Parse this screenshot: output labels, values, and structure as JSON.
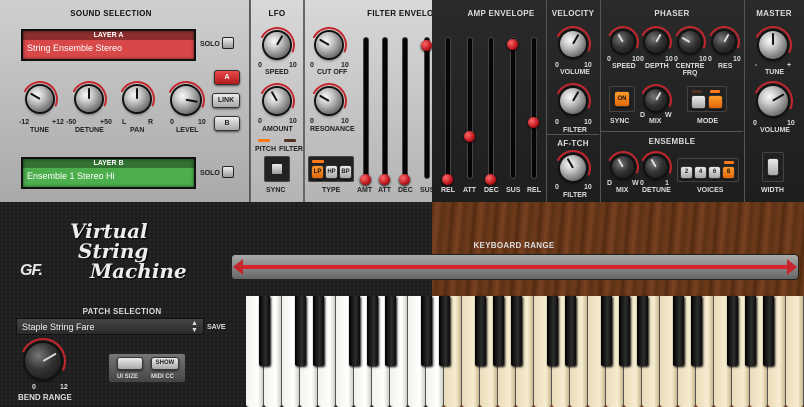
{
  "sound_selection": {
    "title": "SOUND SELECTION",
    "layer_a": {
      "header": "LAYER A",
      "value": "String Ensemble Stereo"
    },
    "layer_b": {
      "header": "LAYER B",
      "value": "Ensemble 1 Stereo Hi"
    },
    "solo_label": "SOLO",
    "a_label": "A",
    "link_label": "LINK",
    "b_label": "B",
    "knobs": [
      {
        "label": "TUNE",
        "min": "-12",
        "max": "+12"
      },
      {
        "label": "DETUNE",
        "min": "-50",
        "max": "+50"
      },
      {
        "label": "PAN",
        "min": "L",
        "max": "R"
      },
      {
        "label": "LEVEL",
        "min": "0",
        "max": "10"
      }
    ]
  },
  "lfo": {
    "title": "LFO",
    "speed": {
      "label": "SPEED",
      "min": "0",
      "max": "10"
    },
    "amount": {
      "label": "AMOUNT",
      "min": "0",
      "max": "10"
    },
    "pitch_label": "PITCH",
    "filter_label": "FILTER",
    "sync_label": "SYNC"
  },
  "filter_envelope": {
    "title": "FILTER ENVELOPE",
    "cutoff": {
      "label": "CUT OFF",
      "min": "0",
      "max": "10"
    },
    "resonance": {
      "label": "RESONANCE",
      "min": "0",
      "max": "10"
    },
    "type_label": "TYPE",
    "types": [
      "LP",
      "HP",
      "BP"
    ],
    "sliders": [
      "AMT",
      "ATT",
      "DEC",
      "SUS",
      "REL"
    ]
  },
  "amp_envelope": {
    "title": "AMP ENVELOPE",
    "sliders": [
      "ATT",
      "DEC",
      "SUS",
      "REL"
    ]
  },
  "velocity": {
    "title": "VELOCITY",
    "volume": {
      "label": "VOLUME",
      "min": "0",
      "max": "10"
    },
    "filter": {
      "label": "FILTER",
      "min": "0",
      "max": "10"
    }
  },
  "af_tch": {
    "title": "AF-TCH",
    "filter": {
      "label": "FILTER",
      "min": "0",
      "max": "10"
    }
  },
  "phaser": {
    "title": "PHASER",
    "knobs": [
      {
        "label": "SPEED",
        "min": "0",
        "max": "10"
      },
      {
        "label": "DEPTH",
        "min": "0",
        "max": "10"
      },
      {
        "label": "CENTRE FRQ",
        "min": "0",
        "max": "10"
      },
      {
        "label": "RES",
        "min": "0",
        "max": "10"
      }
    ],
    "sync_label": "SYNC",
    "sync_on": "ON",
    "mix": {
      "label": "MIX",
      "min": "D",
      "max": "W"
    },
    "mode_label": "MODE"
  },
  "ensemble": {
    "title": "ENSEMBLE",
    "mix": {
      "label": "MIX",
      "min": "D",
      "max": "W"
    },
    "detune": {
      "label": "DETUNE",
      "min": "0",
      "max": "1"
    },
    "voices_label": "VOICES",
    "voices": [
      "2",
      "4",
      "6",
      "8"
    ]
  },
  "master": {
    "title": "MASTER",
    "tune": {
      "label": "TUNE",
      "min": "-",
      "max": "+"
    },
    "volume": {
      "label": "VOLUME",
      "min": "0",
      "max": "10"
    },
    "width_label": "WIDTH"
  },
  "brand": {
    "logo": "GF.",
    "line1": "Virtual",
    "line2": "String",
    "line3": "Machine"
  },
  "keyboard_range": {
    "title": "KEYBOARD RANGE"
  },
  "patch": {
    "title": "PATCH SELECTION",
    "value": "Staple String Fare",
    "save_label": "SAVE",
    "bend_label": "BEND RANGE",
    "bend_min": "0",
    "bend_max": "12",
    "ui_size_label": "UI SIZE",
    "show_label": "SHOW",
    "midi_cc_label": "MIDI CC"
  },
  "colors": {
    "accent_red": "#c4262e",
    "led_orange": "#ff7a1a",
    "layer_a": "#d84848",
    "layer_b": "#4cae4c"
  }
}
